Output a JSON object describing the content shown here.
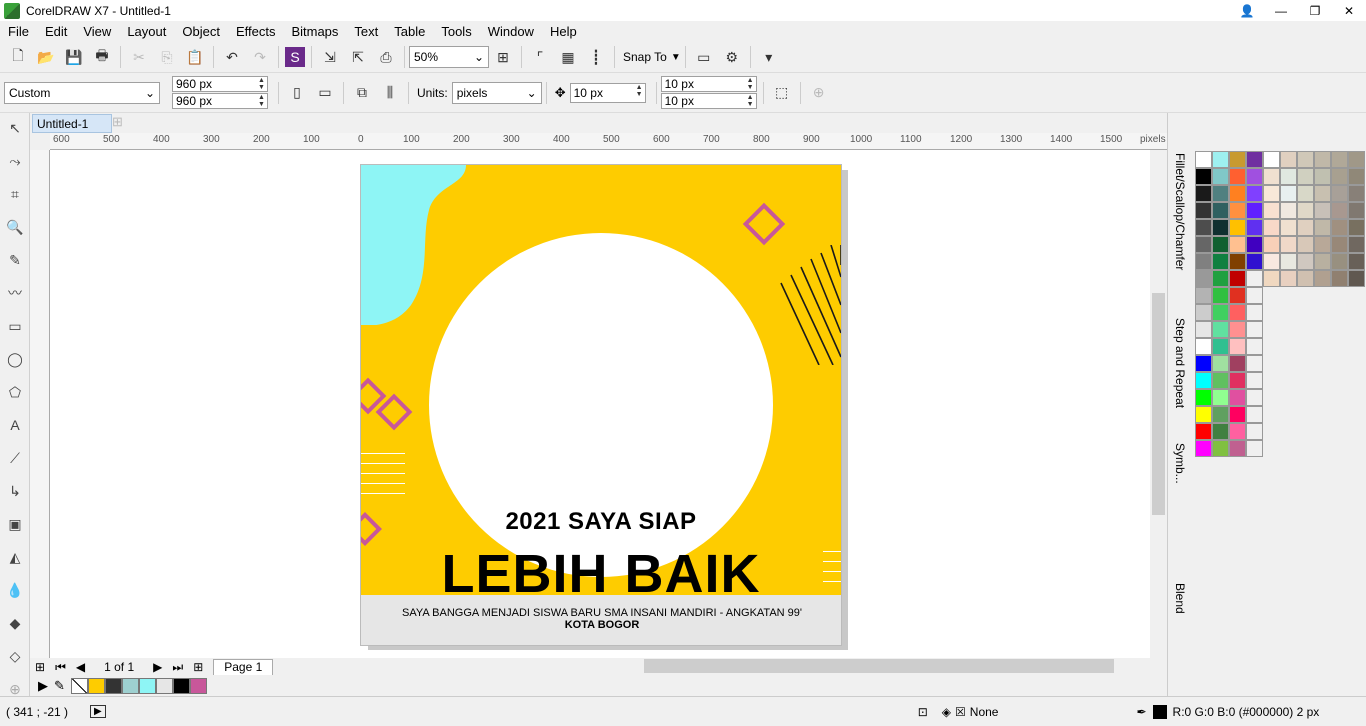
{
  "window": {
    "title": "CorelDRAW X7 - Untitled-1"
  },
  "menu": [
    "File",
    "Edit",
    "View",
    "Layout",
    "Object",
    "Effects",
    "Bitmaps",
    "Text",
    "Table",
    "Tools",
    "Window",
    "Help"
  ],
  "toolbar": {
    "zoom": "50%",
    "snap_to": "Snap To"
  },
  "property_bar": {
    "preset": "Custom",
    "width": "960 px",
    "height": "960 px",
    "units_label": "Units:",
    "units": "pixels",
    "nudge": "10 px",
    "dup_x": "10 px",
    "dup_y": "10 px"
  },
  "doc_tab": "Untitled-1",
  "ruler": {
    "h_ticks": [
      "600",
      "500",
      "400",
      "300",
      "200",
      "100",
      "0",
      "100",
      "200",
      "300",
      "400",
      "500",
      "600",
      "700",
      "800",
      "900",
      "1000",
      "1100",
      "1200",
      "1300",
      "1400",
      "1500"
    ],
    "unit": "pixels"
  },
  "design": {
    "line1": "2021 SAYA SIAP",
    "line2": "LEBIH BAIK",
    "footer1": "SAYA BANGGA MENJADI SISWA BARU SMA INSANI MANDIRI - ANGKATAN 99'",
    "footer2": "KOTA BOGOR"
  },
  "pagenav": {
    "counter": "1 of 1",
    "page_tab": "Page 1"
  },
  "dockers": [
    "Fillet/Scallop/Chamfer",
    "Step and Repeat",
    "Symb...",
    "Blend"
  ],
  "doc_palette": [
    "#fecc00",
    "#333333",
    "#9ed0d0",
    "#8ef5f5",
    "#e6e6e6",
    "#000000",
    "#c8579a"
  ],
  "status": {
    "coords": "( 341  ; -21  )",
    "fill": "None",
    "outline": "R:0 G:0 B:0 (#000000)  2 px"
  }
}
